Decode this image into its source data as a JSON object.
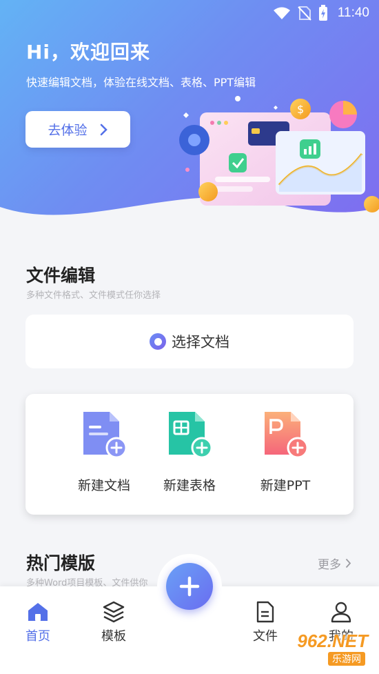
{
  "status_bar": {
    "time": "11:40"
  },
  "hero": {
    "title": "Hi，欢迎回来",
    "subtitle": "快速编辑文档，体验在线文档、表格、PPT编辑",
    "cta_label": "去体验"
  },
  "file_edit": {
    "title": "文件编辑",
    "subtitle": "多种文件格式、文件模式任你选择",
    "choose_label": "选择文档",
    "new_items": [
      {
        "label": "新建文档",
        "icon": "doc-add-icon",
        "color": "#6f7ff0"
      },
      {
        "label": "新建表格",
        "icon": "sheet-add-icon",
        "color": "#22c3a4"
      },
      {
        "label": "新建PPT",
        "icon": "ppt-add-icon",
        "color": "#f87a6e"
      }
    ]
  },
  "hot_templates": {
    "title": "热门模版",
    "subtitle": "多种Word项目模板、文件供你",
    "more_label": "更多"
  },
  "tabbar": {
    "items": [
      {
        "label": "首页",
        "icon": "home-icon",
        "active": true
      },
      {
        "label": "模板",
        "icon": "layers-icon",
        "active": false
      },
      {
        "label": "文件",
        "icon": "file-icon",
        "active": false
      },
      {
        "label": "我的",
        "icon": "user-icon",
        "active": false
      }
    ],
    "fab_icon": "plus-icon"
  },
  "watermark": {
    "brand": "962.NET",
    "sub": "乐游网"
  },
  "colors": {
    "accent": "#5470e8",
    "hero_start": "#63b3f5",
    "hero_end": "#7f6cf0"
  }
}
